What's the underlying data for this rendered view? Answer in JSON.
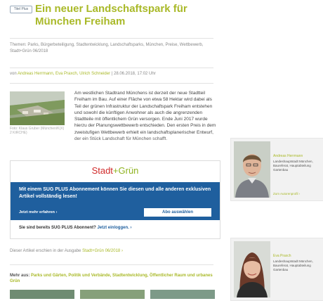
{
  "article": {
    "badge": "Titel Plus",
    "title": "Ein neuer Landschaftspark für München Freiham",
    "topics": "Themen: Parks, Bürgerbeteiligung, Stadtentwicklung, Landschaftsparks, München, Preise, Wettbewerb, Stadt+Grün 06/2018",
    "byline_prefix": "von",
    "authors": "Andreas Herrmann, Eva Praxch, Ulrich Schneider",
    "date": "| 28.06.2018, 17:02 Uhr",
    "image_caption": "Foto: Klaus Gruber (München/K(X) 2 KIRCHE)",
    "lead": "Am westlichen Stadtrand Münchens ist derzeit der neue Stadtteil Freiham im Bau. Auf einer Fläche von etwa 58 Hektar wird dabei als Teil der grünen Infrastruktur der Landschaftspark Freiham entstehen und sowohl die künftigen Anwohner als auch die angrenzenden Stadtteile mit öffentlichem Grün versorgen. Ende Juni 2017 wurde hierzu der Planungswettbewerb entschieden. Den ersten Preis in dem zweistufigen Wettbewerb erhielt ein landschaftsplanerischer Entwurf, der ein Stück Landschaft für München schafft."
  },
  "paywall": {
    "logo_a": "Stadt",
    "logo_sep": "+",
    "logo_b": "Grün",
    "message": "Mit einem SUG PLUS Abonnement können Sie diesen und alle anderen exklusiven Artikel vollständig lesen!",
    "more_label": "Jetzt mehr erfahren ›",
    "select_button": "Abo auswählen",
    "subscriber_q": "Sie sind bereits SUG PLUS Abonnent?",
    "login_link": "Jetzt einloggen. ›"
  },
  "footer": {
    "issue_prefix": "Dieser Artikel erschien in der Ausgabe",
    "issue_link": "Stadt+Grün 06/2018 ›",
    "more_prefix": "Mehr aus:",
    "more_links": "Parks und Gärten, Politik und Verbände, Stadtentwicklung, Öffentlicher Raum und urbanes Grün"
  },
  "authors_sidebar": [
    {
      "name": "Andreas Herrmann",
      "desc": "Landeshauptstadt München, Baureferat, Hauptabteilung Gartenbau",
      "link": "Zum Autorenprofil ›"
    },
    {
      "name": "Eva Praxch",
      "desc": "Landeshauptstadt München, Baureferat, Hauptabteilung Gartenbau"
    }
  ],
  "colors": {
    "accent": "#a9b928",
    "paywall_blue": "#1f5f9e",
    "logo_red": "#d02a2a"
  }
}
